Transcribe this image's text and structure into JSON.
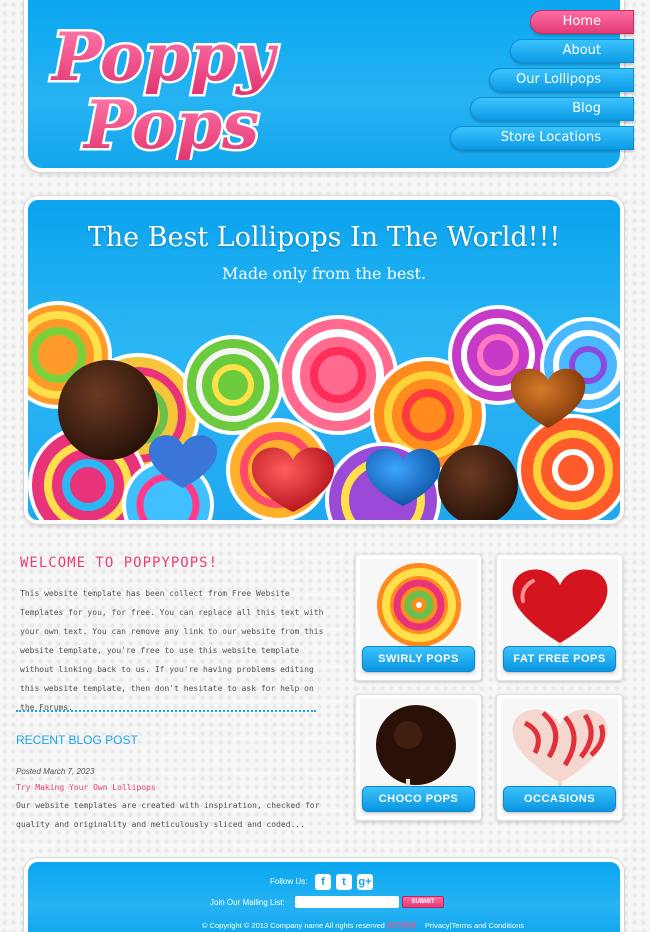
{
  "logo": {
    "line1": "Poppy",
    "line2": "Pops"
  },
  "nav": [
    {
      "label": "Home",
      "active": true
    },
    {
      "label": "About",
      "active": false
    },
    {
      "label": "Our Lollipops",
      "active": false
    },
    {
      "label": "Blog",
      "active": false
    },
    {
      "label": "Store Locations",
      "active": false
    }
  ],
  "hero": {
    "title": "The Best Lollipops In The World!!!",
    "subtitle": "Made only from the best."
  },
  "welcome": {
    "title": "WELCOME TO POPPYPOPS!",
    "body": "This website template has been collect from Free Website Templates for you, for free. You can replace all this text with your own text. You can remove any link to our website from this website template, you're free to use this website template without linking back to us. If you're having problems editing this website template, then don't hesitate to ask for help on the Forums."
  },
  "blog": {
    "heading": "RECENT BLOG POST",
    "date": "Posted March 7, 2023",
    "post_title": "Try Making Your Own Lollipops",
    "excerpt": "Our website templates are created with inspiration, checked for quality and originality and meticulously sliced and coded..."
  },
  "products": [
    {
      "label": "SWIRLY POPS",
      "icon": "swirl-lollipop-icon"
    },
    {
      "label": "FAT FREE POPS",
      "icon": "red-heart-lollipop-icon"
    },
    {
      "label": "CHOCO POPS",
      "icon": "chocolate-lollipop-icon"
    },
    {
      "label": "OCCASIONS",
      "icon": "striped-heart-lollipop-icon"
    }
  ],
  "footer": {
    "follow_label": "Follow Us:",
    "social": [
      {
        "glyph": "f",
        "icon": "facebook-icon"
      },
      {
        "glyph": "t",
        "icon": "twitter-icon"
      },
      {
        "glyph": "g+",
        "icon": "google-plus-icon"
      }
    ],
    "mailing_label": "Join Our Mailing List:",
    "mailing_placeholder": "",
    "submit_label": "SUBMIT",
    "copyright": "© Copyright © 2013 Company name All rights reserved",
    "stamp": "网页模板",
    "privacy": "Privacy",
    "terms": "Terms and Conditions"
  },
  "colors": {
    "blue": "#1aa3e8",
    "pink": "#e93e7e",
    "background": "#f6f6f6"
  }
}
